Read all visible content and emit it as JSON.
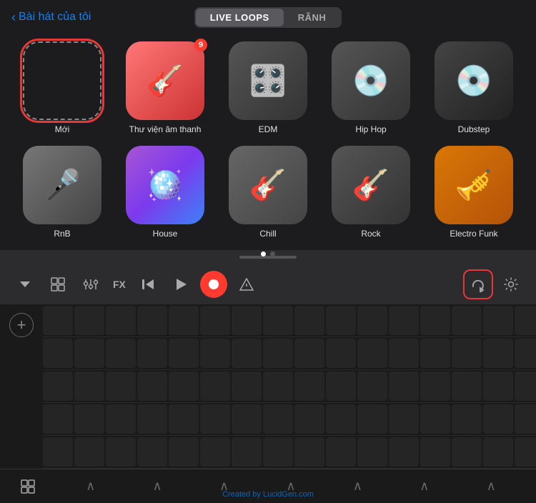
{
  "header": {
    "back_label": "Bài hát của tôi",
    "tabs": [
      {
        "label": "LIVE LOOPS",
        "active": true
      },
      {
        "label": "RÃNH",
        "active": false
      }
    ]
  },
  "grid": {
    "row1": [
      {
        "id": "new",
        "label": "Mới",
        "type": "new"
      },
      {
        "id": "thu-vien",
        "label": "Thư viện âm thanh",
        "type": "thu-vien",
        "badge": "9"
      },
      {
        "id": "edm",
        "label": "EDM",
        "type": "edm"
      },
      {
        "id": "hiphop",
        "label": "Hip Hop",
        "type": "hiphop"
      },
      {
        "id": "dubstep",
        "label": "Dubstep",
        "type": "dubstep"
      }
    ],
    "row2": [
      {
        "id": "rnb",
        "label": "RnB",
        "type": "rnb"
      },
      {
        "id": "house",
        "label": "House",
        "type": "house"
      },
      {
        "id": "chill",
        "label": "Chill",
        "type": "chill"
      },
      {
        "id": "rock",
        "label": "Rock",
        "type": "rock"
      },
      {
        "id": "electrofunk",
        "label": "Electro Funk",
        "type": "electrofunk"
      }
    ],
    "dots": [
      {
        "active": true
      },
      {
        "active": false
      }
    ]
  },
  "toolbar": {
    "dropdown_icon": "▾",
    "grid_icon": "⊞",
    "mixer_icon": "⚙",
    "fx_label": "FX",
    "rewind_icon": "⏮",
    "play_icon": "▶",
    "record_icon": "●",
    "smartcontrol_icon": "△",
    "loop_icon": "↺",
    "settings_icon": "⚙"
  },
  "track_area": {
    "add_label": "+",
    "rows": 5,
    "cells_per_row": 16
  },
  "bottom_nav": {
    "left_icon": "⊞",
    "chevrons": [
      "∧",
      "∧",
      "∧",
      "∧",
      "∧",
      "∧",
      "∧"
    ],
    "watermark": "Created by LucidGen.com"
  }
}
